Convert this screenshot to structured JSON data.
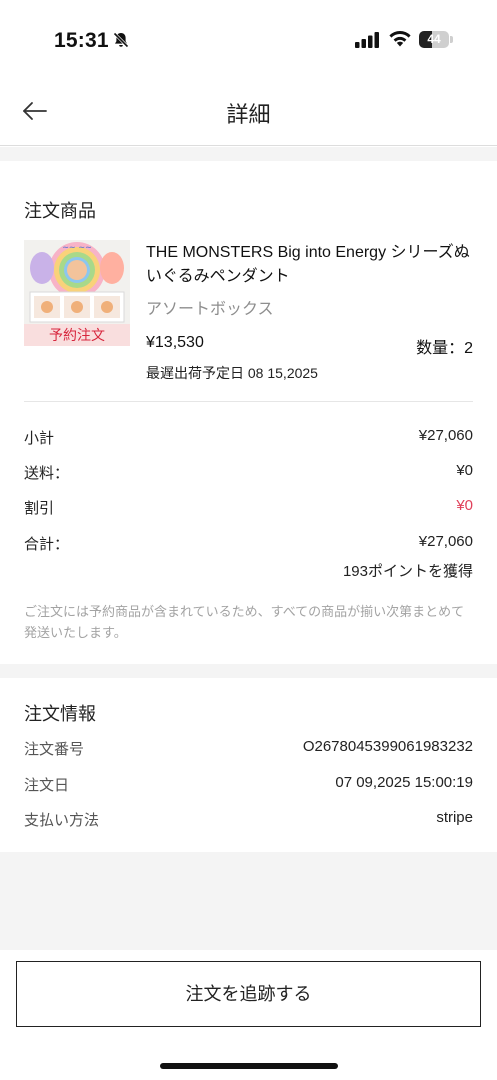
{
  "status_bar": {
    "time": "15:31",
    "battery_level": "44",
    "battery_fraction": 0.44,
    "icons": [
      "bell-slash-icon",
      "cellular-signal-icon",
      "wifi-icon",
      "battery-icon"
    ]
  },
  "header": {
    "title": "詳細",
    "back_icon": "arrow-left-icon"
  },
  "order_items": {
    "section_title": "注文商品",
    "product": {
      "name": "THE MONSTERS Big into Energy シリーズぬいぐるみペンダント",
      "variant": "アソートボックス",
      "badge": "予約注文",
      "price": "¥13,530",
      "quantity": "数量：2",
      "ship_date": "最遅出荷予定日 08 15,2025"
    },
    "summary": {
      "subtotal_label": "小計",
      "subtotal_value": "¥27,060",
      "shipping_label": "送料：",
      "shipping_value": "¥0",
      "discount_label": "割引",
      "discount_value": "¥0",
      "total_label": "合計：",
      "total_value": "¥27,060",
      "points": "193ポイントを獲得"
    },
    "notice": "ご注文には予約商品が含まれているため、すべての商品が揃い次第まとめて発送いたします。"
  },
  "order_info": {
    "section_title": "注文情報",
    "order_number_label": "注文番号",
    "order_number_value": "O267804539906198323​2",
    "order_date_label": "注文日",
    "order_date_value": "07 09,2025 15:00:19",
    "payment_label": "支払い方法",
    "payment_value": "stripe"
  },
  "actions": {
    "track_label": "注文を追跡する"
  },
  "colors": {
    "accent_red": "#e0405a",
    "badge_bg": "#f9dede",
    "gap_gray": "#f4f4f4"
  }
}
